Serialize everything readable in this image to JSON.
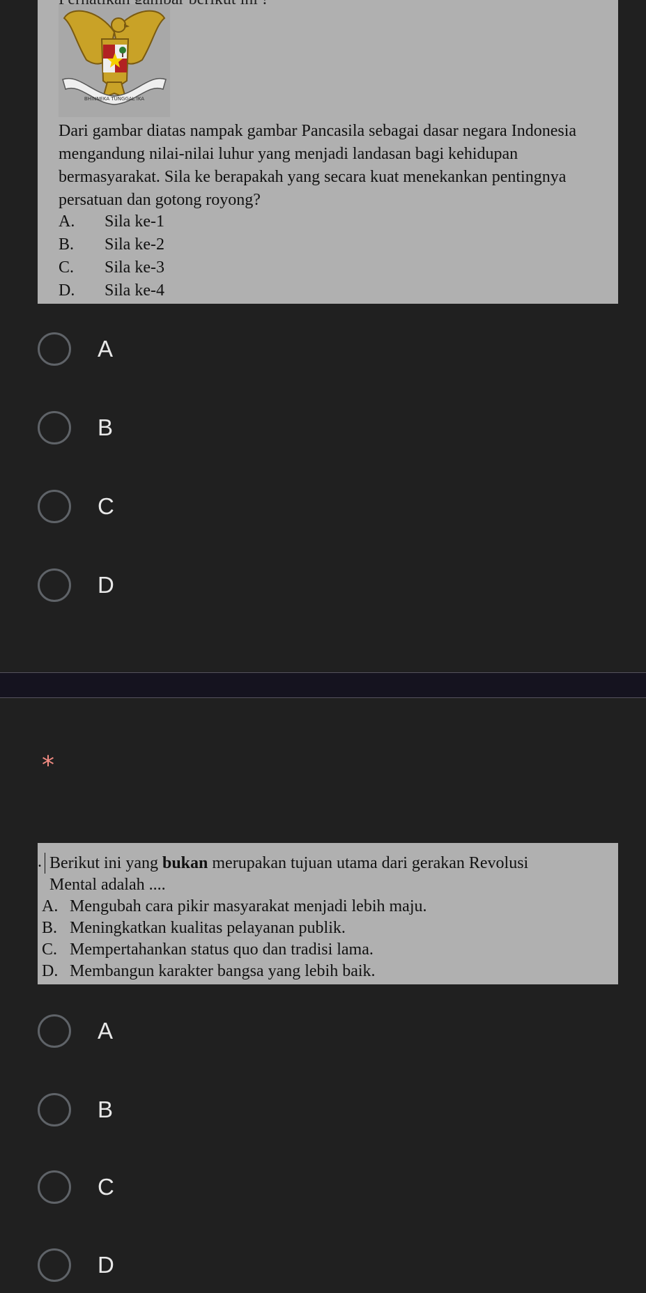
{
  "question1": {
    "top_text": "Perhatikan gambar berikut ini !",
    "emblem_text": "BHINNEKA TUNGGAL IKA",
    "passage": "Dari gambar diatas nampak gambar Pancasila sebagai dasar negara Indonesia mengandung nilai-nilai luhur yang menjadi landasan bagi kehidupan bermasyarakat. Sila ke berapakah yang secara kuat menekankan pentingnya persatuan dan gotong royong?",
    "options": [
      {
        "letter": "A.",
        "text": "Sila ke-1"
      },
      {
        "letter": "B.",
        "text": "Sila ke-2"
      },
      {
        "letter": "C.",
        "text": "Sila ke-3"
      },
      {
        "letter": "D.",
        "text": "Sila ke-4"
      }
    ],
    "choices": [
      "A",
      "B",
      "C",
      "D"
    ]
  },
  "question2": {
    "required_mark": "*",
    "prefix": ".",
    "passage_before_bold": "Berikut ini yang ",
    "passage_bold": "bukan",
    "passage_after_bold": " merupakan tujuan utama dari gerakan Revolusi",
    "passage_line2": "Mental adalah ....",
    "options": [
      {
        "letter": "A.",
        "text": "Mengubah cara pikir masyarakat menjadi lebih maju."
      },
      {
        "letter": "B.",
        "text": "Meningkatkan kualitas pelayanan publik."
      },
      {
        "letter": "C.",
        "text": "Mempertahankan status quo dan tradisi lama."
      },
      {
        "letter": "D.",
        "text": "Membangun karakter bangsa yang lebih baik."
      }
    ],
    "choices": [
      "A",
      "B",
      "C",
      "D"
    ]
  },
  "colors": {
    "background": "#202020",
    "image_bg": "#b0b0b0",
    "required": "#f28b82",
    "radio_border": "#5f6368"
  }
}
